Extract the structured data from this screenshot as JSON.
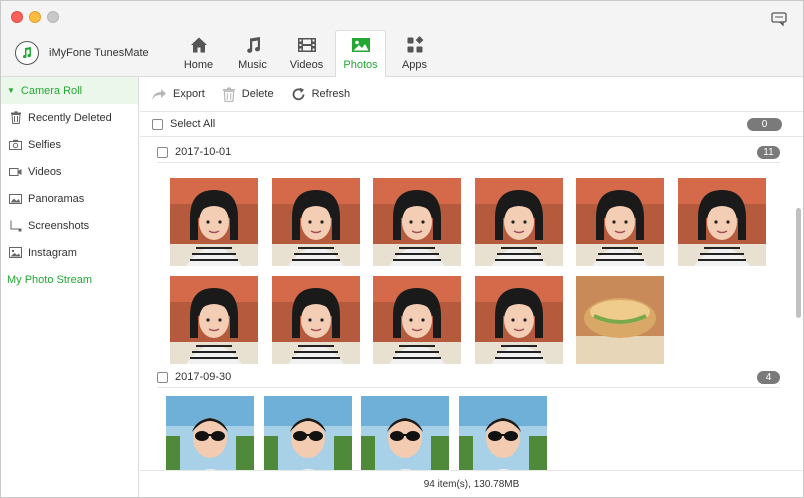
{
  "app": {
    "name": "iMyFone TunesMate"
  },
  "nav": [
    {
      "label": "Home",
      "icon": "home-icon"
    },
    {
      "label": "Music",
      "icon": "music-icon"
    },
    {
      "label": "Videos",
      "icon": "video-icon"
    },
    {
      "label": "Photos",
      "icon": "photos-icon",
      "active": true
    },
    {
      "label": "Apps",
      "icon": "apps-icon"
    }
  ],
  "sidebar": {
    "items": [
      {
        "label": "Camera Roll",
        "icon": "caret-down-icon",
        "active": true
      },
      {
        "label": "Recently Deleted",
        "icon": "trash-icon"
      },
      {
        "label": "Selfies",
        "icon": "camera-icon"
      },
      {
        "label": "Videos",
        "icon": "video-camera-icon"
      },
      {
        "label": "Panoramas",
        "icon": "panorama-icon"
      },
      {
        "label": "Screenshots",
        "icon": "screenshot-icon"
      },
      {
        "label": "Instagram",
        "icon": "image-icon"
      },
      {
        "label": "My Photo Stream",
        "icon": ""
      }
    ]
  },
  "toolbar": {
    "export_label": "Export",
    "delete_label": "Delete",
    "refresh_label": "Refresh"
  },
  "select_all": {
    "label": "Select All",
    "count": "0"
  },
  "groups": [
    {
      "date": "2017-10-01",
      "count": "11"
    },
    {
      "date": "2017-09-30",
      "count": "4"
    }
  ],
  "status": {
    "text": "94 item(s), 130.78MB"
  },
  "colors": {
    "accent": "#22a832",
    "pill": "#7a7a7a",
    "sidebar_active_bg": "#ecf7ec"
  }
}
